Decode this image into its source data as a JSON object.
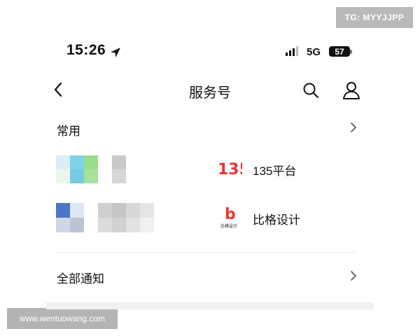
{
  "watermarks": {
    "top": "TG: MYYJJPP",
    "bottom": "www.wentuowang.com"
  },
  "status_bar": {
    "time": "15:26",
    "network": "5G",
    "battery": "57",
    "location_icon": "location-arrow-icon",
    "signal_icon": "signal-bars-icon"
  },
  "nav": {
    "title": "服务号",
    "back_icon": "chevron-left-icon",
    "search_icon": "search-icon",
    "profile_icon": "person-icon"
  },
  "sections": {
    "frequent": {
      "title": "常用",
      "chevron_icon": "chevron-right-icon"
    },
    "all": {
      "title": "全部通知",
      "chevron_icon": "chevron-right-icon"
    }
  },
  "accounts": [
    {
      "name": "135平台",
      "icon": "logo-135-icon",
      "icon_text": "135"
    },
    {
      "name": "比格设计",
      "icon": "logo-bige-icon",
      "icon_text": "b",
      "icon_caption": "比格设计"
    }
  ],
  "colors": {
    "accent_red": "#e63b2e",
    "text": "#111111",
    "divider": "#ececec"
  }
}
